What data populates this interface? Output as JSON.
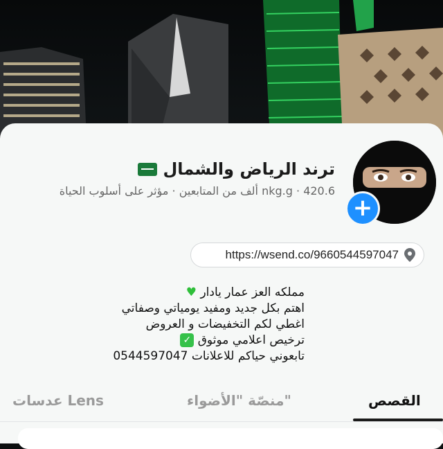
{
  "profile": {
    "name": "ترند الرياض والشمال",
    "flag_icon": "saudi-flag-icon",
    "username": "nkg.g",
    "followers_count": "420.6",
    "followers_label": "ألف من المتابعين",
    "category": "مؤثر على أسلوب الحياة",
    "separator": "·"
  },
  "link": {
    "url": "https://wsend.co/9660544597047",
    "icon": "location-pin-icon"
  },
  "bio": {
    "line1": "مملكه العز عمار يادار",
    "line1_icon": "green-heart-icon",
    "line2": "اهتم بكل جديد ومفيد يومياتي وصفاتي",
    "line3": "اغطي لكم  التخفيضات و العروض",
    "line4": "ترخيص اعلامي موثوق",
    "line4_icon": "check-mark-icon",
    "line5": "تابعوني حياكم للاعلانات  0544597047"
  },
  "tabs": [
    {
      "label": "القصص",
      "active": true
    },
    {
      "label": "منصّة \"الأضواء\"",
      "active": false
    },
    {
      "label": "عدسات Lens",
      "active": false
    }
  ],
  "colors": {
    "accent": "#1e90ff",
    "green": "#2fbf3a"
  }
}
